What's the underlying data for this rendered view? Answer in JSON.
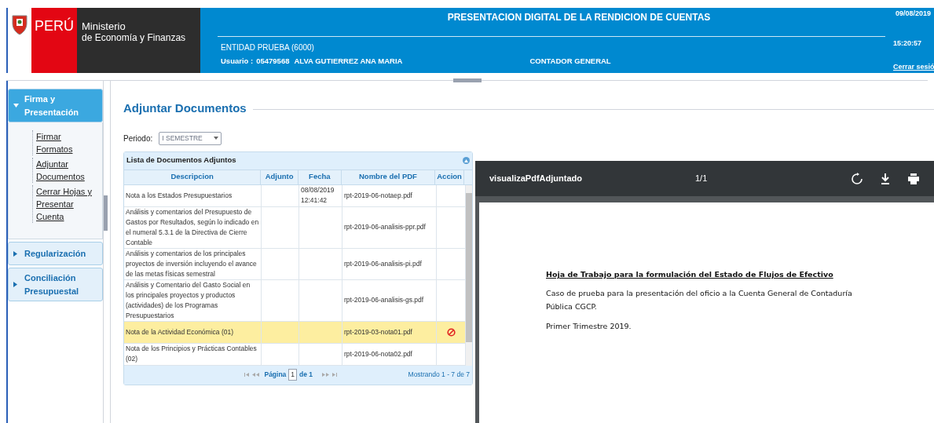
{
  "header": {
    "logo_country": "PERÚ",
    "logo_line1": "Ministerio",
    "logo_line2": "de Economía y Finanzas",
    "title": "PRESENTACION DIGITAL DE LA RENDICION DE CUENTAS",
    "entity": "ENTIDAD PRUEBA (6000)",
    "user_label": "Usuario :",
    "user_id": "05479568",
    "user_name": "ALVA GUTIERREZ ANA MARIA",
    "role": "CONTADOR GENERAL",
    "date": "09/08/2019",
    "time": "15:20:57",
    "logout": "Cerrar sesió"
  },
  "sidebar": {
    "sections": [
      {
        "label": "Firma y Presentación",
        "expanded": true,
        "children": [
          {
            "label": "Firmar Formatos"
          },
          {
            "label": "Adjuntar Documentos"
          },
          {
            "label": "Cerrar Hojas y Presentar Cuenta"
          }
        ]
      },
      {
        "label": "Regularización",
        "expanded": false
      },
      {
        "label": "Conciliación Presupuestal",
        "expanded": false
      }
    ]
  },
  "main": {
    "title": "Adjuntar Documentos",
    "period_label": "Periodo:",
    "period_value": "I SEMESTRE",
    "grid": {
      "caption": "Lista de Documentos Adjuntos",
      "columns": [
        "Descripcion",
        "Adjunto",
        "Fecha",
        "Nombre del PDF",
        "Accion"
      ],
      "rows": [
        {
          "description": "Nota a los Estados Presupuestarios",
          "date": "08/08/2019 12:41:42",
          "pdf": "rpt-2019-06-notaep.pdf",
          "selected": false,
          "deletable": false
        },
        {
          "description": "Análisis y comentarios del Presupuesto de Gastos por Resultados, según lo indicado en el numeral 5.3.1 de la Directiva de Cierre Contable",
          "pdf": "rpt-2019-06-analisis-ppr.pdf",
          "selected": false,
          "deletable": false
        },
        {
          "description": "Análisis y comentarios de los principales proyectos de inversión incluyendo el avance de las metas físicas semestral",
          "pdf": "rpt-2019-06-analisis-pi.pdf",
          "selected": false,
          "deletable": false
        },
        {
          "description": "Análisis y Comentario del Gasto Social en los principales proyectos y productos (actividades) de los Programas Presupuestarios",
          "pdf": "rpt-2019-06-analisis-gs.pdf",
          "selected": false,
          "deletable": false
        },
        {
          "description": "Nota de la Actividad Económica (01)",
          "pdf": "rpt-2019-03-nota01.pdf",
          "selected": true,
          "deletable": true
        },
        {
          "description": "Nota de los Principios y Prácticas Contables (02)",
          "pdf": "rpt-2019-06-nota02.pdf",
          "selected": false,
          "deletable": false
        }
      ],
      "pager": {
        "page_label": "Página",
        "page": "1",
        "of": "de 1",
        "summary": "Mostrando 1 - 7 de 7"
      }
    }
  },
  "pdf_viewer": {
    "title": "visualizaPdfAdjuntado",
    "pages": "1/1",
    "heading": "Hoja de Trabajo para la formulación del Estado de Flujos de Efectivo",
    "paragraphs": [
      "Caso de prueba para la presentación del oficio a la Cuenta General de Contaduría Pública CGCP.",
      "Primer Trimestre  2019."
    ]
  }
}
